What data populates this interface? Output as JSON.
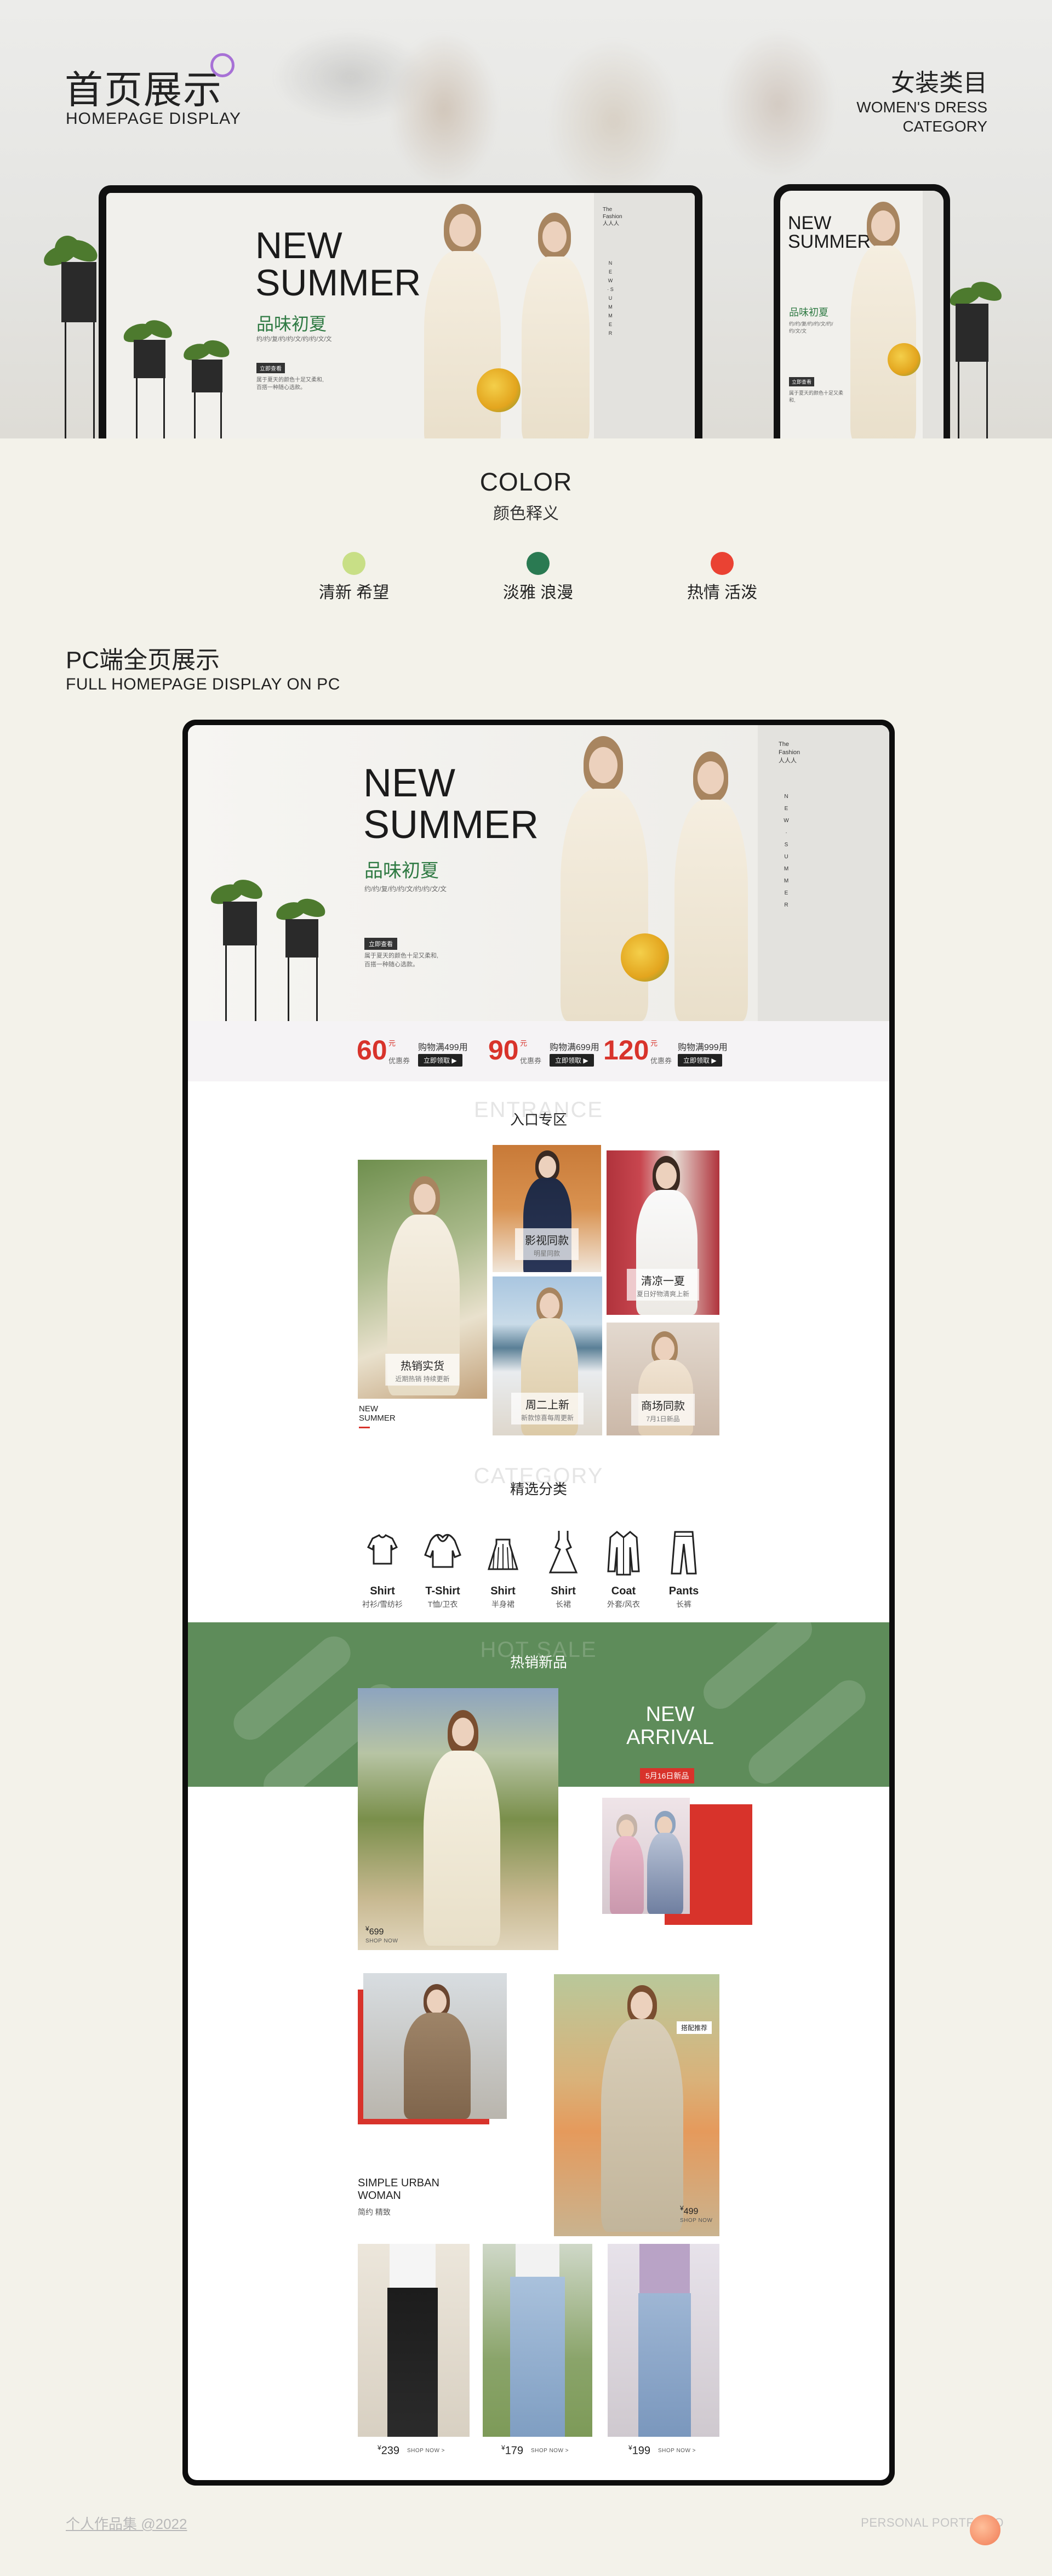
{
  "header": {
    "title_zh": "首页展示",
    "title_en": "HOMEPAGE DISPLAY",
    "category_zh": "女装类目",
    "category_en_line1": "WOMEN'S DRESS",
    "category_en_line2": "CATEGORY",
    "accent_color": "#a771d6"
  },
  "banner": {
    "headline_line1": "NEW",
    "headline_line2": "SUMMER",
    "tagline_zh": "品味初夏",
    "small_copy": "约/约/复/约/约/文/约/约/文/文",
    "button_label": "立即查看",
    "body_line1": "属于夏天的颜色十足又柔和,",
    "body_line2": "百搭一种随心选款。",
    "side_line1": "The",
    "side_line2": "Fashion",
    "side_line3": "人人人",
    "side_vertical": "N E W · S U M M E R"
  },
  "colors": {
    "title": "COLOR",
    "subtitle": "颜色释义",
    "items": [
      {
        "hex": "#c8df86",
        "label": "清新 希望"
      },
      {
        "hex": "#2a7a52",
        "label": "淡雅 浪漫"
      },
      {
        "hex": "#ea4233",
        "label": "热情 活泼"
      }
    ]
  },
  "pc_section": {
    "title_zh": "PC端全页展示",
    "title_en": "FULL HOMEPAGE DISPLAY ON PC"
  },
  "coupons": [
    {
      "amount": "60",
      "unit": "元",
      "type": "优惠券",
      "condition": "购物满499用",
      "button": "立即领取 ▶"
    },
    {
      "amount": "90",
      "unit": "元",
      "type": "优惠券",
      "condition": "购物满699用",
      "button": "立即领取 ▶"
    },
    {
      "amount": "120",
      "unit": "元",
      "type": "优惠券",
      "condition": "购物满999用",
      "button": "立即领取 ▶"
    }
  ],
  "entrance": {
    "ghost": "ENTRANCE",
    "heading": "入口专区",
    "tiles": [
      {
        "title": "热销实货",
        "sub": "近期热销 持续更新"
      },
      {
        "title": "影视同款",
        "sub": "明星同款"
      },
      {
        "title": "清凉一夏",
        "sub": "夏日好物清爽上新"
      },
      {
        "title": "周二上新",
        "sub": "新款惊喜每周更新"
      },
      {
        "title": "商场同款",
        "sub": "7月1日新品"
      }
    ],
    "caption_line1": "NEW",
    "caption_line2": "SUMMER"
  },
  "category": {
    "ghost": "CATEGORY",
    "heading": "精选分类",
    "items": [
      {
        "en": "Shirt",
        "zh": "衬衫/雪纺衫",
        "icon": "shirt-icon"
      },
      {
        "en": "T-Shirt",
        "zh": "T恤/卫衣",
        "icon": "tshirt-icon"
      },
      {
        "en": "Shirt",
        "zh": "半身裙",
        "icon": "skirt-icon"
      },
      {
        "en": "Shirt",
        "zh": "长裙",
        "icon": "dress-icon"
      },
      {
        "en": "Coat",
        "zh": "外套/风衣",
        "icon": "coat-icon"
      },
      {
        "en": "Pants",
        "zh": "长裤",
        "icon": "pants-icon"
      }
    ]
  },
  "hot_sale": {
    "ghost": "HOT SALE",
    "heading": "热销新品",
    "arrival_line1": "NEW",
    "arrival_line2": "ARRIVAL",
    "date_badge": "5月16日新品",
    "band_color": "#5e8c5a",
    "price_1": "699",
    "shop_now": "SHOP NOW",
    "urban_line1": "SIMPLE URBAN",
    "urban_line2": "WOMAN",
    "urban_zh": "简约 精致",
    "recommend_tag": "搭配推荐",
    "price_2": "499"
  },
  "bottom_products": [
    {
      "price": "239",
      "cta": "SHOP NOW >"
    },
    {
      "price": "179",
      "cta": "SHOP NOW >"
    },
    {
      "price": "199",
      "cta": "SHOP NOW >"
    }
  ],
  "footer": {
    "left": "个人作品集 @2022",
    "right": "PERSONAL PORTFOLIO"
  }
}
